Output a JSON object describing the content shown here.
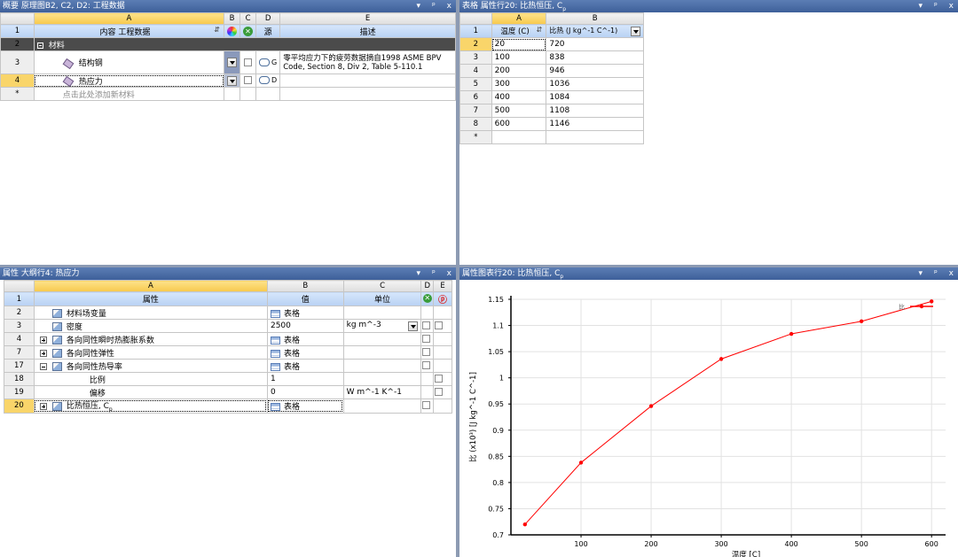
{
  "outline": {
    "title": "概要 原理图B2, C2, D2: 工程数据",
    "controls": [
      "▾",
      "ᵖ",
      "x"
    ],
    "columns": [
      "A",
      "B",
      "C",
      "D",
      "E"
    ],
    "header": {
      "rownum": "1",
      "content": "内容 工程数据",
      "source": "源",
      "description": "描述"
    },
    "category": {
      "rownum": "2",
      "label": "材料"
    },
    "rows": [
      {
        "rownum": "3",
        "name": "结构钢",
        "source_letter": "G",
        "description": "零平均应力下的疲劳数据摘自1998 ASME BPV Code, Section 8, Div 2, Table 5-110.1"
      },
      {
        "rownum": "4",
        "name": "热应力",
        "source_letter": "D",
        "description": ""
      }
    ],
    "add_row": {
      "rownum": "*",
      "label": "点击此处添加新材料"
    }
  },
  "table": {
    "title": "表格 属性行20: 比热恒压, C",
    "title_sub": "p",
    "controls": [
      "▾",
      "ᵖ",
      "x"
    ],
    "columns": [
      "A",
      "B"
    ],
    "header": {
      "rownum": "1",
      "temp": "温度 (C)",
      "heat": "比热 (J kg^-1 C^-1)"
    },
    "rows": [
      {
        "rownum": "2",
        "temp": "20",
        "heat": "720"
      },
      {
        "rownum": "3",
        "temp": "100",
        "heat": "838"
      },
      {
        "rownum": "4",
        "temp": "200",
        "heat": "946"
      },
      {
        "rownum": "5",
        "temp": "300",
        "heat": "1036"
      },
      {
        "rownum": "6",
        "temp": "400",
        "heat": "1084"
      },
      {
        "rownum": "7",
        "temp": "500",
        "heat": "1108"
      },
      {
        "rownum": "8",
        "temp": "600",
        "heat": "1146"
      }
    ],
    "add_row": {
      "rownum": "*"
    }
  },
  "properties": {
    "title": "属性 大纲行4: 热应力",
    "controls": [
      "▾",
      "ᵖ",
      "x"
    ],
    "columns": [
      "A",
      "B",
      "C",
      "D",
      "E"
    ],
    "header": {
      "rownum": "1",
      "property": "属性",
      "value": "值",
      "unit": "单位"
    },
    "rows": [
      {
        "rownum": "2",
        "expand": "",
        "icon": true,
        "name": "材料场变量",
        "value": "表格",
        "value_icon": true,
        "unit": "",
        "unit_dd": false,
        "d_check": false,
        "e_check": false
      },
      {
        "rownum": "3",
        "expand": "",
        "icon": true,
        "name": "密度",
        "value": "2500",
        "value_icon": false,
        "unit": "kg m^-3",
        "unit_dd": true,
        "d_check": true,
        "e_check": true
      },
      {
        "rownum": "4",
        "expand": "plus",
        "icon": true,
        "name": "各向同性瞬时热膨胀系数",
        "value": "表格",
        "value_icon": true,
        "unit": "",
        "unit_dd": false,
        "d_check": true,
        "e_check": false
      },
      {
        "rownum": "7",
        "expand": "plus",
        "icon": true,
        "name": "各向同性弹性",
        "value": "表格",
        "value_icon": true,
        "unit": "",
        "unit_dd": false,
        "d_check": true,
        "e_check": false
      },
      {
        "rownum": "17",
        "expand": "minus",
        "icon": true,
        "name": "各向同性热导率",
        "value": "表格",
        "value_icon": true,
        "unit": "",
        "unit_dd": false,
        "d_check": true,
        "e_check": false
      },
      {
        "rownum": "18",
        "expand": "",
        "icon": false,
        "name": "比例",
        "value": "1",
        "value_icon": false,
        "unit": "",
        "unit_dd": false,
        "d_check": false,
        "e_check": true
      },
      {
        "rownum": "19",
        "expand": "",
        "icon": false,
        "name": "偏移",
        "value": "0",
        "value_icon": false,
        "unit": "W m^-1 K^-1",
        "unit_dd": false,
        "d_check": false,
        "e_check": true
      },
      {
        "rownum": "20",
        "expand": "plus",
        "icon": true,
        "name": "比热恒压, C",
        "value": "表格",
        "value_icon": true,
        "unit": "",
        "unit_dd": false,
        "d_check": true,
        "e_check": false
      }
    ],
    "last_name_sub": "p"
  },
  "chart": {
    "title": "属性图表行20: 比热恒压, C",
    "title_sub": "p",
    "controls": [
      "▾",
      "ᵖ",
      "x"
    ],
    "legend_label": "比",
    "colors": {
      "series": "#ff0000"
    }
  },
  "chart_data": {
    "type": "line",
    "x": [
      20,
      100,
      200,
      300,
      400,
      500,
      600
    ],
    "y": [
      0.72,
      0.838,
      0.946,
      1.036,
      1.084,
      1.108,
      1.146
    ],
    "xlabel": "温度 [C]",
    "ylabel": "比 (x10³) [J kg^-1 C^-1]",
    "xlim": [
      0,
      620
    ],
    "ylim": [
      0.7,
      1.15
    ],
    "xticks": [
      100,
      200,
      300,
      400,
      500,
      600
    ],
    "yticks": [
      0.7,
      0.75,
      0.8,
      0.85,
      0.9,
      0.95,
      1,
      1.05,
      1.1,
      1.15
    ],
    "grid": true,
    "legend": "top-right"
  }
}
